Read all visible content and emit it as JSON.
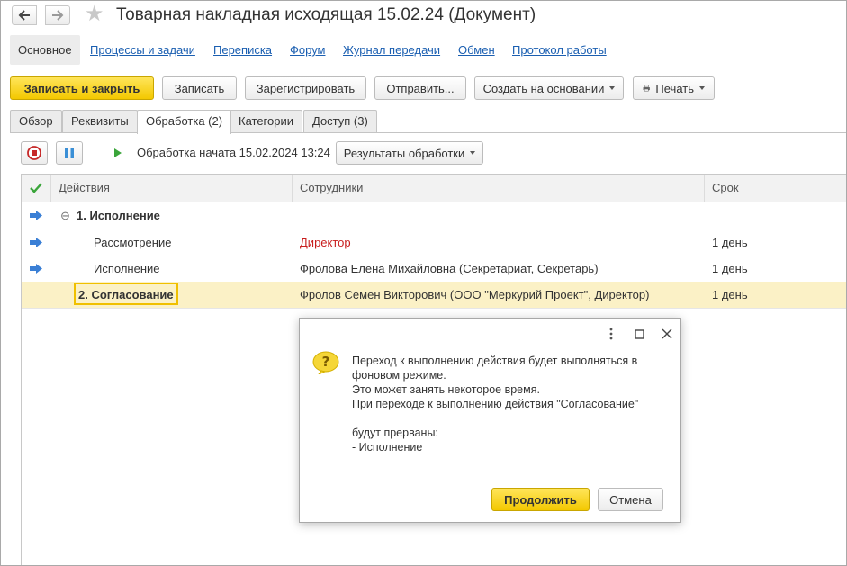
{
  "window": {
    "title": "Товарная накладная исходящая 15.02.24 (Документ)"
  },
  "sections": [
    {
      "label": "Основное",
      "active": true
    },
    {
      "label": "Процессы и задачи"
    },
    {
      "label": "Переписка"
    },
    {
      "label": "Форум"
    },
    {
      "label": "Журнал передачи"
    },
    {
      "label": "Обмен"
    },
    {
      "label": "Протокол работы"
    }
  ],
  "toolbar": {
    "save_close": "Записать и закрыть",
    "save": "Записать",
    "register": "Зарегистрировать",
    "send": "Отправить...",
    "create_based": "Создать на основании",
    "print": "Печать"
  },
  "tabs": [
    {
      "label": "Обзор"
    },
    {
      "label": "Реквизиты"
    },
    {
      "label": "Обработка (2)",
      "active": true
    },
    {
      "label": "Категории"
    },
    {
      "label": "Доступ (3)"
    }
  ],
  "processing": {
    "status": "Обработка начата 15.02.2024 13:24",
    "results_button": "Результаты обработки"
  },
  "table": {
    "headers": {
      "actions": "Действия",
      "employees": "Сотрудники",
      "term": "Срок"
    },
    "rows": [
      {
        "action": "1. Исполнение",
        "employee": "",
        "term": "",
        "group": true
      },
      {
        "action": "Рассмотрение",
        "employee": "Директор",
        "term": "1 день"
      },
      {
        "action": "Исполнение",
        "employee": "Фролова Елена Михайловна (Секретариат, Секретарь)",
        "term": "1 день"
      },
      {
        "action": "2. Согласование",
        "employee": "Фролов Семен Викторович (ООО \"Меркурий Проект\", Директор)",
        "term": "1 день",
        "selected": true
      }
    ]
  },
  "dialog": {
    "message": "Переход к выполнению действия будет выполняться в\nфоновом режиме.\nЭто может занять некоторое время.\nПри переходе к выполнению действия \"Согласование\"\n\nбудут прерваны:\n- Исполнение",
    "continue": "Продолжить",
    "cancel": "Отмена"
  },
  "colors": {
    "accent": "#f3c800",
    "link": "#1b5fb1",
    "warning_text": "#c81e1e",
    "selected_row": "#fbf1c6"
  }
}
